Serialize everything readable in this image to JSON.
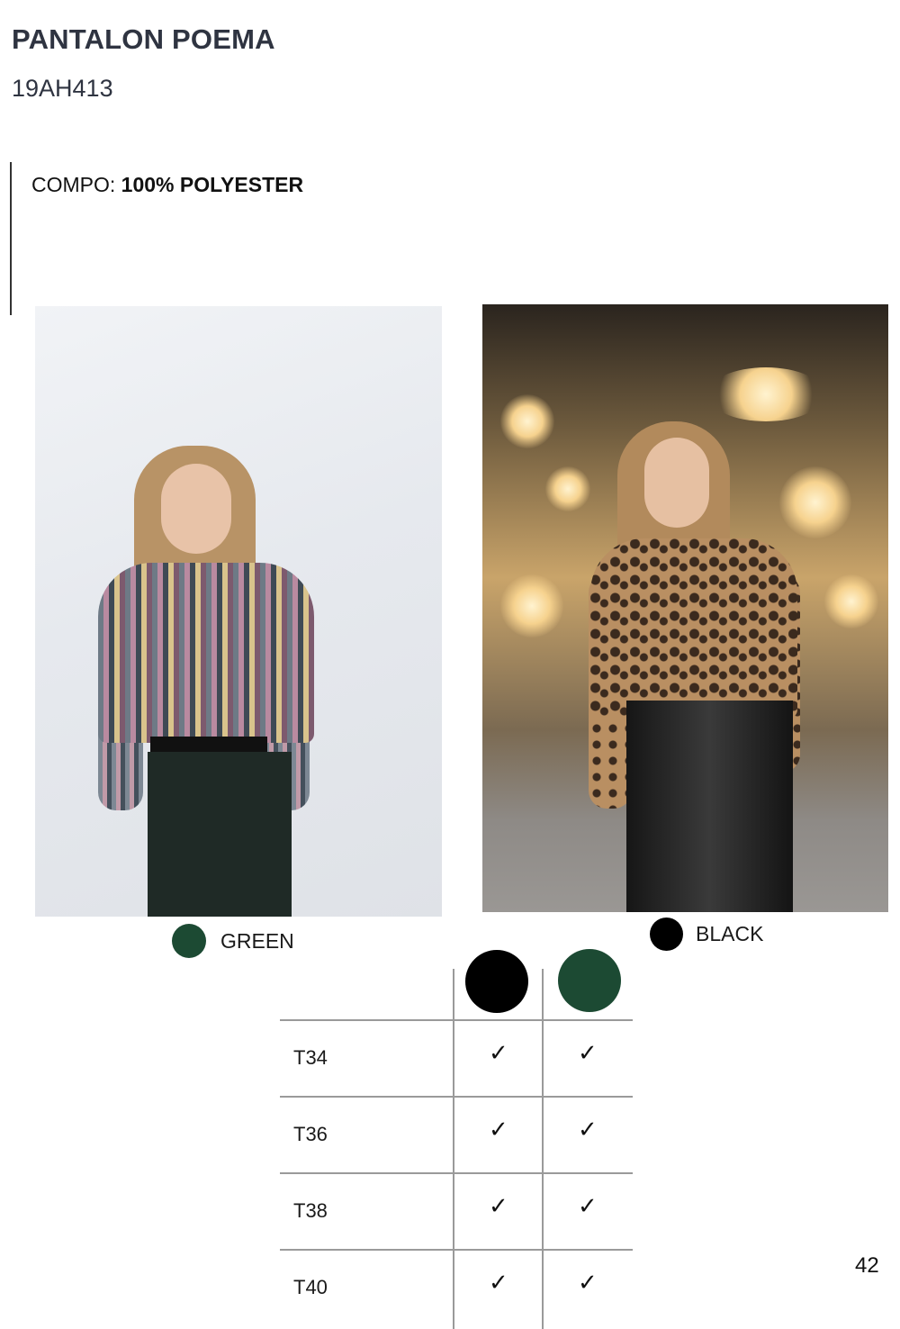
{
  "header": {
    "title": "PANTALON POEMA",
    "reference": "19AH413"
  },
  "composition": {
    "label": "COMPO:",
    "value": "100% POLYESTER"
  },
  "colors": [
    {
      "name": "GREEN",
      "hex": "#1c4a33"
    },
    {
      "name": "BLACK",
      "hex": "#000000"
    }
  ],
  "availability_table": {
    "column_swatches": [
      "#000000",
      "#1c4a33"
    ],
    "rows": [
      {
        "size": "T34",
        "marks": [
          "✓",
          "✓"
        ]
      },
      {
        "size": "T36",
        "marks": [
          "✓",
          "✓"
        ]
      },
      {
        "size": "T38",
        "marks": [
          "✓",
          "✓"
        ]
      },
      {
        "size": "T40",
        "marks": [
          "✓",
          "✓"
        ]
      }
    ]
  },
  "page_number": "42"
}
